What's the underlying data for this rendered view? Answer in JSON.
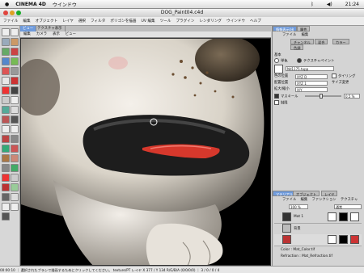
{
  "system_menubar": {
    "apple": "",
    "app_name": "CINEMA 4D",
    "window_menu": "ウインドウ",
    "clock": "21:24"
  },
  "window": {
    "title": "DOG_Paint04.c4d"
  },
  "app_menus": [
    "ファイル",
    "編集",
    "オブジェクト",
    "レイヤ",
    "選択",
    "フィルタ",
    "ポリゴンを描画",
    "UV 編集",
    "ツール",
    "プラグイン",
    "レンダリング",
    "ウインドウ",
    "ヘルプ"
  ],
  "viewport": {
    "tabs": [
      "ビュー",
      "テクスチャ表示"
    ],
    "menu": [
      "編集",
      "カメラ",
      "表示",
      "ビュー"
    ]
  },
  "right_panel": {
    "top_tabs": [
      "情報表示/出",
      "属性"
    ],
    "attr_menu": [
      "ファイル",
      "編集"
    ],
    "attr_tabs": [
      "チャンネル",
      "混合",
      "カラー"
    ],
    "attr_tab2": "色調",
    "section_title": "基本",
    "radio_color": "単色",
    "radio_texture": "テクスチャペイント",
    "texture_file": "Nd1175.tupp",
    "color_scale_label": "色の位置",
    "color_scale_value": "XYZ D",
    "pos_label": "配置位置",
    "pos_value": "XYZ 1",
    "tiling_label": "タイリング",
    "scale_label": "拡大/縮小",
    "scale_value": "X/Y",
    "offset_label": "位置",
    "size_label": "サイズ変更",
    "mask_label": "マスキール",
    "mask_value": "0.5 %",
    "limit_label": "制限",
    "layer_tabs": [
      "マテリアル",
      "オブジェクト",
      "レイヤ"
    ],
    "layer_menu": [
      "ファイル",
      "編集",
      "ファンクション",
      "テクスチャ"
    ],
    "zoom_value": "100 %",
    "blend_mode": "通常",
    "layers": [
      {
        "name": "Mat 1"
      },
      {
        "name": "背景"
      },
      {
        "name": "Color : Mat_Color.tif"
      },
      {
        "name": "Refraction : Mat_Refraction.tif"
      }
    ]
  },
  "status_bar": {
    "text": "00:00:10 ｜ 選択されたブラシで描画するためにクリックしてください。 texture/PT レイヤ  X 377 / Y 134  R/G/B/A (0/0/0/0)  ｜ 3 / 0 / 0 / 4"
  },
  "colors": {
    "accent_highlight": "#3c78d8",
    "tab_active": "#6f9bdc",
    "viewport_bg": "#000000",
    "panel_bg": "#d4d4d4"
  }
}
